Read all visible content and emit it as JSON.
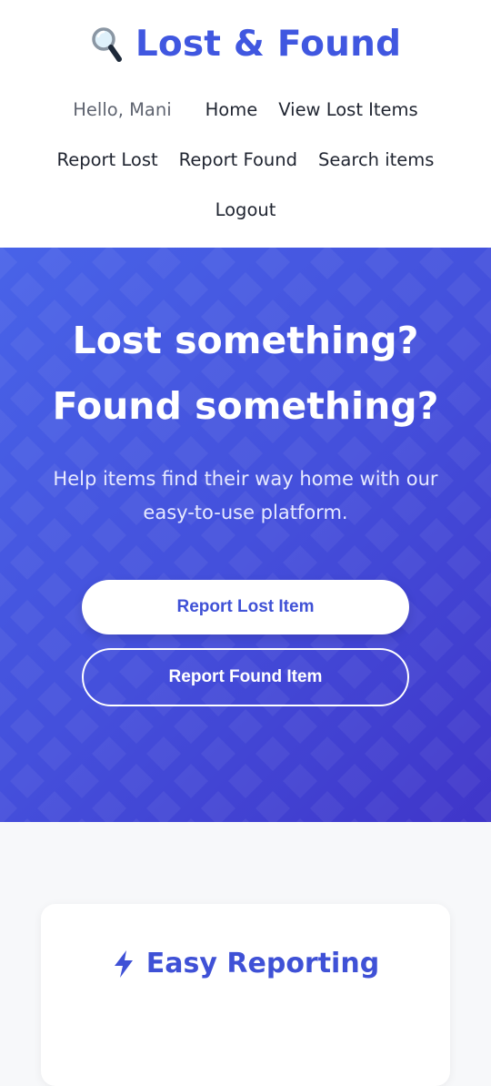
{
  "header": {
    "brand_icon": "magnifying-glass-icon",
    "title": "Lost & Found",
    "greeting": "Hello, Mani",
    "nav": {
      "home": "Home",
      "view_lost": "View Lost Items",
      "report_lost": "Report Lost",
      "report_found": "Report Found",
      "search": "Search items",
      "logout": "Logout"
    }
  },
  "hero": {
    "title_line1": "Lost something?",
    "title_line2": "Found something?",
    "subtitle_line1": "Help items find their way home with our",
    "subtitle_line2": "easy-to-use platform.",
    "primary_button": "Report Lost Item",
    "secondary_button": "Report Found Item"
  },
  "features": {
    "card1": {
      "icon": "lightning-bolt-icon",
      "title": "Easy Reporting"
    }
  },
  "colors": {
    "brand": "#4057e0",
    "hero_start": "#4863e8",
    "hero_end": "#3f35c9",
    "background": "#f7f8fa"
  }
}
